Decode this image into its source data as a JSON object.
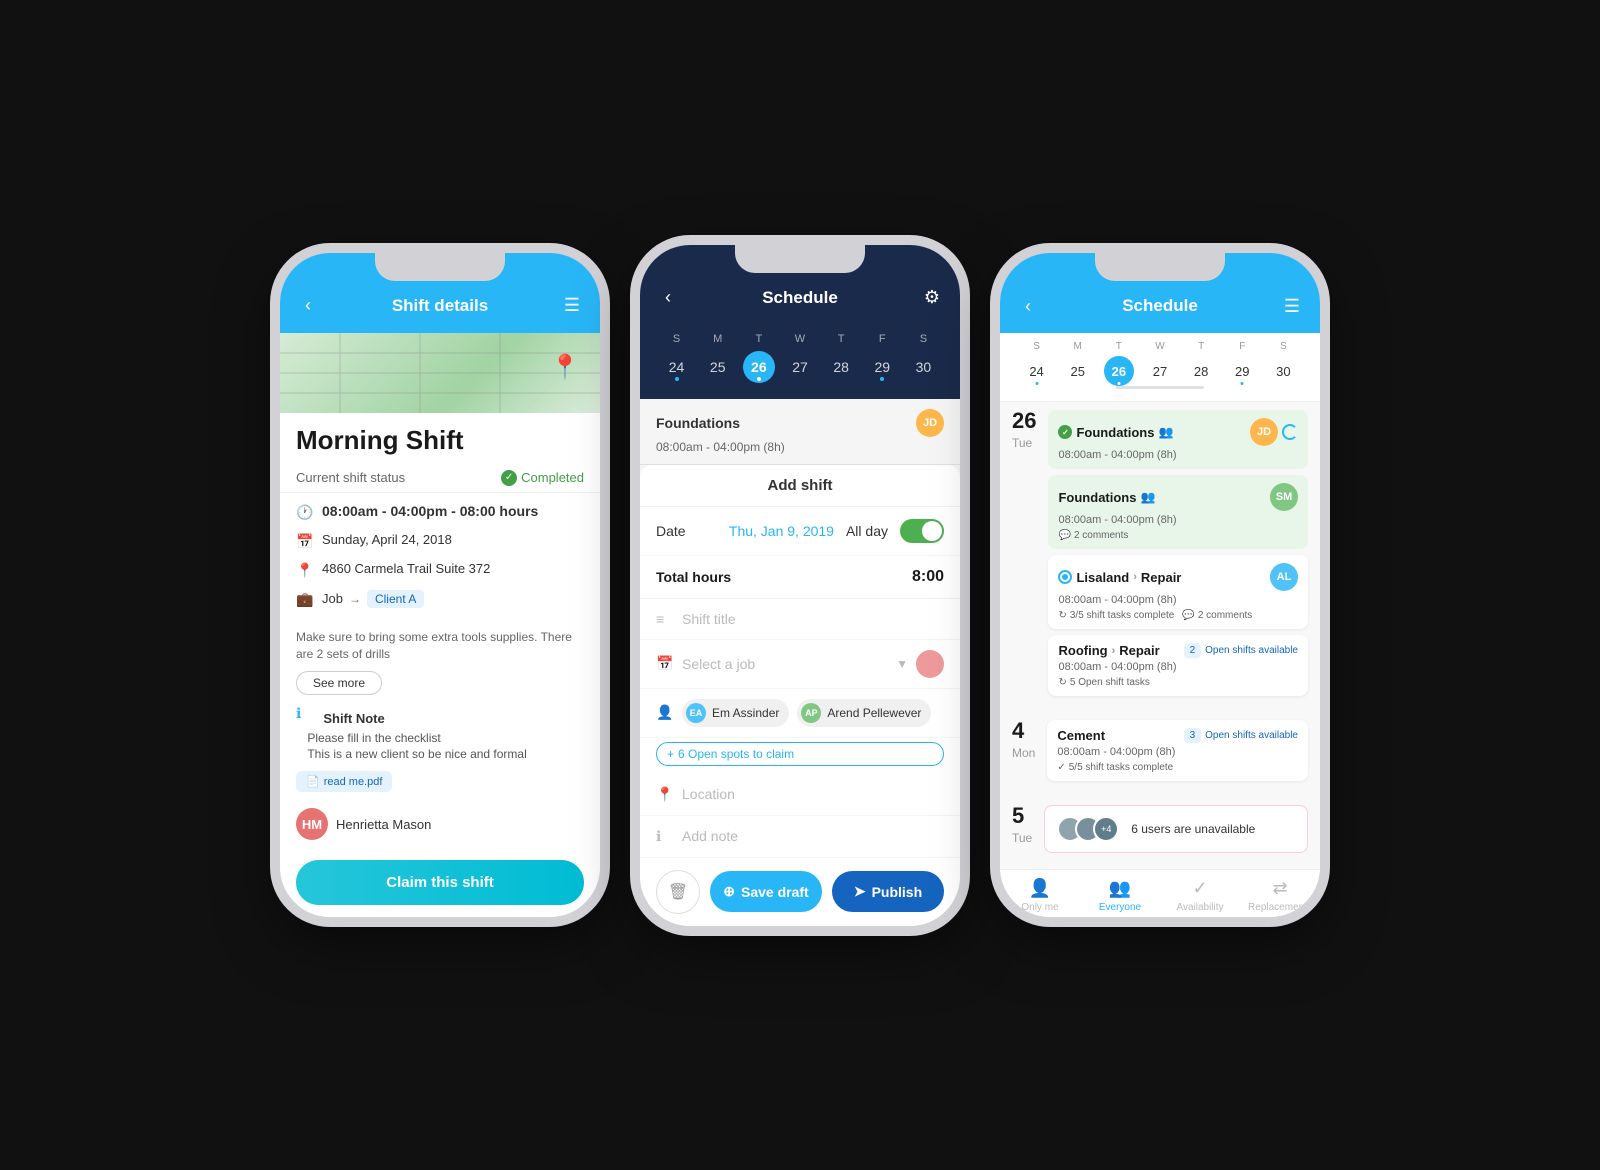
{
  "phone1": {
    "header": {
      "title": "Shift details",
      "back_label": "‹",
      "menu_label": "☰"
    },
    "shift_title": "Morning Shift",
    "status_label": "Current shift status",
    "status_value": "Completed",
    "time_info": "08:00am - 04:00pm - 08:00 hours",
    "date_info": "Sunday, April 24, 2018",
    "address": "4860 Carmela Trail Suite 372",
    "job_label": "Job",
    "job_arrow": "→",
    "job_value": "Client A",
    "note_text": "Make sure to bring some extra tools supplies. There are 2 sets of drills",
    "see_more": "See more",
    "shift_note_title": "Shift Note",
    "shift_note_line1": "Please fill in the checklist",
    "shift_note_line2": "This is a new client so be nice and formal",
    "pdf_file": "read me.pdf",
    "assignee_name": "Henrietta Mason",
    "claim_btn": "Claim this shift"
  },
  "phone2": {
    "header": {
      "title": "Schedule",
      "back_label": "‹",
      "gear_label": "⚙"
    },
    "calendar": {
      "days": [
        "S",
        "M",
        "T",
        "W",
        "T",
        "F",
        "S"
      ],
      "dates": [
        {
          "num": "24",
          "active": false,
          "dot": true
        },
        {
          "num": "25",
          "active": false,
          "dot": false
        },
        {
          "num": "26",
          "active": true,
          "dot": true
        },
        {
          "num": "27",
          "active": false,
          "dot": false
        },
        {
          "num": "28",
          "active": false,
          "dot": false
        },
        {
          "num": "29",
          "active": false,
          "dot": true
        },
        {
          "num": "30",
          "active": false,
          "dot": false
        }
      ]
    },
    "existing_shift": {
      "title": "Foundations",
      "time": "08:00am - 04:00pm (8h)"
    },
    "add_shift_title": "Add shift",
    "date_label": "Date",
    "date_value": "Thu, Jan 9, 2019",
    "allday_label": "All day",
    "total_hours_label": "Total hours",
    "total_hours_value": "8:00",
    "shift_title_placeholder": "Shift title",
    "select_job_placeholder": "Select a job",
    "assignees": [
      "Em Assinder",
      "Arend Pellewever"
    ],
    "open_spots": "+ 6 Open spots to claim",
    "location_placeholder": "Location",
    "add_note_placeholder": "Add note",
    "delete_btn": "🗑",
    "save_draft_btn": "Save draft",
    "publish_btn": "Publish"
  },
  "phone3": {
    "header": {
      "title": "Schedule",
      "back_label": "‹",
      "menu_label": "☰"
    },
    "calendar": {
      "days": [
        "S",
        "M",
        "T",
        "W",
        "T",
        "F",
        "S"
      ],
      "dates": [
        {
          "num": "24",
          "active": false,
          "dot": true
        },
        {
          "num": "25",
          "active": false,
          "dot": false
        },
        {
          "num": "26",
          "active": true,
          "dot": true
        },
        {
          "num": "27",
          "active": false,
          "dot": false
        },
        {
          "num": "28",
          "active": false,
          "dot": false
        },
        {
          "num": "29",
          "active": false,
          "dot": true
        },
        {
          "num": "30",
          "active": false,
          "dot": false
        }
      ]
    },
    "sections": [
      {
        "day_num": "26",
        "day_name": "Tue",
        "shifts": [
          {
            "type": "green",
            "title": "Foundations",
            "icon": "check",
            "people": true,
            "time": "08:00am - 04:00pm (8h)",
            "has_refresh": true,
            "open_shifts": null,
            "tasks": null,
            "comments": null
          },
          {
            "type": "green",
            "title": "Foundations",
            "icon": null,
            "people": true,
            "time": "08:00am - 04:00pm (8h)",
            "has_refresh": false,
            "open_shifts": null,
            "tasks": null,
            "comments": "2 comments"
          },
          {
            "type": "white",
            "title": "Lisaland",
            "sub": "Repair",
            "icon": "radio",
            "people": false,
            "time": "08:00am - 04:00pm (8h)",
            "has_refresh": false,
            "open_shifts": null,
            "tasks": "3/5 shift tasks complete",
            "comments": "2 comments"
          },
          {
            "type": "white",
            "title": "Roofing",
            "sub": "Repair",
            "icon": null,
            "people": false,
            "time": "08:00am - 04:00pm (8h)",
            "has_refresh": false,
            "open_shifts": "2",
            "open_shifts_label": "Open shifts available",
            "tasks": "5 Open shift tasks",
            "comments": null
          }
        ]
      },
      {
        "day_num": "4",
        "day_name": "Mon",
        "shifts": [
          {
            "type": "white",
            "title": "Cement",
            "icon": null,
            "people": false,
            "time": "08:00am - 04:00pm (8h)",
            "has_refresh": false,
            "open_shifts": "3",
            "open_shifts_label": "Open shifts available",
            "tasks": "5/5 shift tasks complete",
            "comments": null
          }
        ]
      },
      {
        "day_num": "5",
        "day_name": "Tue",
        "unavailable": "6 users are unavailable",
        "unavail_count": "+4"
      }
    ],
    "bottom_nav": [
      {
        "label": "Only me",
        "icon": "👤",
        "active": false
      },
      {
        "label": "Everyone",
        "icon": "👥",
        "active": true
      },
      {
        "label": "Availability",
        "icon": "✓",
        "active": false
      },
      {
        "label": "Replacements",
        "icon": "↔",
        "active": false
      }
    ]
  }
}
